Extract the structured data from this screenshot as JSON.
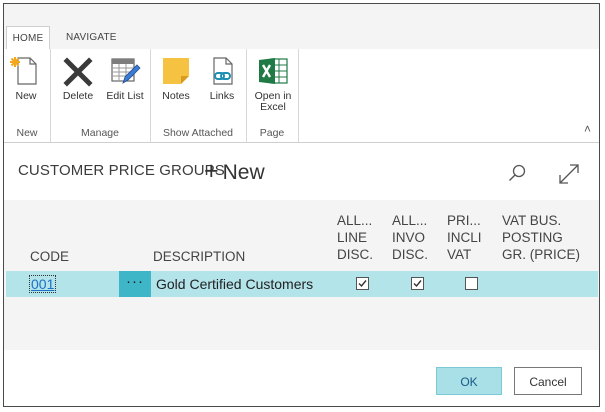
{
  "ribbon": {
    "tabs": [
      {
        "label": "HOME",
        "active": true
      },
      {
        "label": "NAVIGATE",
        "active": false
      }
    ],
    "groups": [
      {
        "label": "New",
        "buttons": [
          {
            "label": "New",
            "icon": "new-document-icon"
          }
        ]
      },
      {
        "label": "Manage",
        "buttons": [
          {
            "label": "Delete",
            "icon": "delete-x-icon"
          },
          {
            "label": "Edit List",
            "icon": "edit-list-icon"
          }
        ]
      },
      {
        "label": "Show Attached",
        "buttons": [
          {
            "label": "Notes",
            "icon": "notes-icon"
          },
          {
            "label": "Links",
            "icon": "links-icon"
          }
        ]
      },
      {
        "label": "Page",
        "buttons": [
          {
            "label": "Open in Excel",
            "icon": "excel-icon"
          }
        ]
      }
    ],
    "collapse_icon": "chevron-up-icon"
  },
  "header": {
    "title": "CUSTOMER PRICE GROUPS",
    "new_label": "New",
    "new_plus": "+"
  },
  "grid": {
    "columns": [
      {
        "key": "code",
        "label": "CODE"
      },
      {
        "key": "description",
        "label": "DESCRIPTION"
      },
      {
        "key": "allow_line_disc",
        "label": [
          "ALL...",
          "LINE",
          "DISC."
        ]
      },
      {
        "key": "allow_invoice_disc",
        "label": [
          "ALL...",
          "INVO",
          "DISC."
        ]
      },
      {
        "key": "price_incl_vat",
        "label": [
          "PRI...",
          "INCLI",
          "VAT"
        ]
      },
      {
        "key": "vat_bus_posting",
        "label": [
          "VAT BUS.",
          "POSTING",
          "GR. (PRICE)"
        ]
      }
    ],
    "rows": [
      {
        "code": "001",
        "row_menu": "···",
        "description": "Gold Certified Customers",
        "allow_line_disc": true,
        "allow_invoice_disc": true,
        "price_incl_vat": false,
        "vat_bus_posting": ""
      }
    ]
  },
  "footer": {
    "ok_label": "OK",
    "cancel_label": "Cancel"
  },
  "colors": {
    "selected_row": "#b3e4ea",
    "row_menu_bg": "#3fb6c8",
    "excel_green": "#1f7a45",
    "notes_yellow": "#f5c242",
    "link_blue": "#1e6fc7",
    "ok_bg": "#a9dfe6"
  }
}
